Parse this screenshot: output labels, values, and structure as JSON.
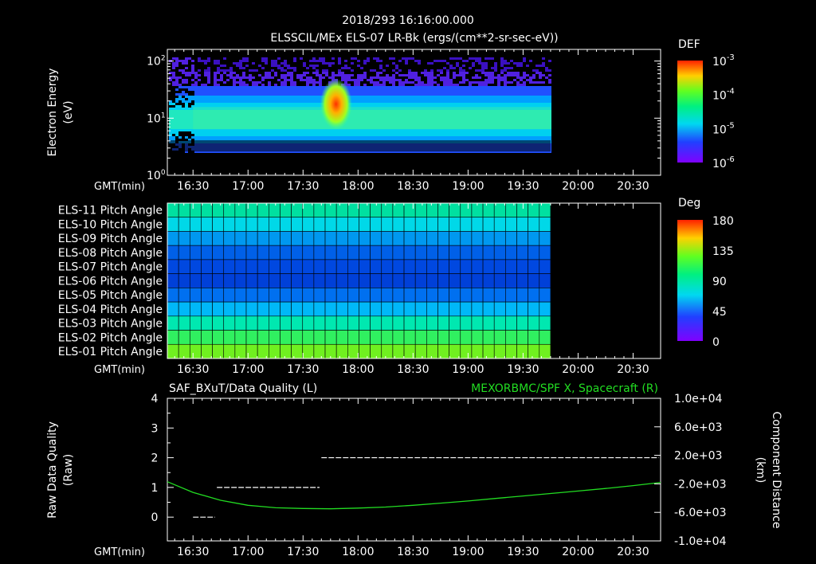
{
  "header": {
    "datetime": "2018/293 16:16:00.000",
    "title": "ELSSCIL/MEx ELS-07 LR-Bk  (ergs/(cm**2-sr-sec-eV))"
  },
  "time_axis": {
    "label": "GMT(min)",
    "ticks": [
      "16:30",
      "17:00",
      "17:30",
      "18:00",
      "18:30",
      "19:00",
      "19:30",
      "20:00",
      "20:30"
    ],
    "tick_minutes": [
      990,
      1020,
      1050,
      1080,
      1110,
      1140,
      1170,
      1200,
      1230
    ],
    "range_minutes": [
      976,
      1245
    ],
    "data_end_minutes": 1185
  },
  "panel1": {
    "ylabel_line1": "Electron Energy",
    "ylabel_line2": "(eV)",
    "ytick_base": [
      "10",
      "10",
      "10"
    ],
    "ytick_exp": [
      "0",
      "1",
      "2"
    ],
    "ytick_values": [
      1,
      10,
      100
    ],
    "yrange": [
      1,
      160
    ],
    "scale": "log",
    "colorbar": {
      "label": "DEF",
      "tick_base": [
        "10",
        "10",
        "10",
        "10"
      ],
      "tick_exp": [
        "-3",
        "-4",
        "-5",
        "-6"
      ],
      "tick_values": [
        0.001,
        0.0001,
        1e-05,
        1e-06
      ],
      "scale": "log"
    }
  },
  "panel2": {
    "rows": [
      "ELS-11 Pitch Angle",
      "ELS-10 Pitch Angle",
      "ELS-09 Pitch Angle",
      "ELS-08 Pitch Angle",
      "ELS-07 Pitch Angle",
      "ELS-06 Pitch Angle",
      "ELS-05 Pitch Angle",
      "ELS-04 Pitch Angle",
      "ELS-03 Pitch Angle",
      "ELS-02 Pitch Angle",
      "ELS-01 Pitch Angle"
    ],
    "row_colors": [
      "#00e0a0",
      "#00d8e8",
      "#0098f0",
      "#0060e8",
      "#0048e0",
      "#0040d8",
      "#0070f0",
      "#00b8f8",
      "#00e8b0",
      "#30f060",
      "#70f020"
    ],
    "colorbar": {
      "label": "Deg",
      "ticks": [
        "180",
        "135",
        "90",
        "45",
        "0"
      ],
      "tick_values": [
        180,
        135,
        90,
        45,
        0
      ]
    }
  },
  "panel3": {
    "left_title": "SAF_BXuT/Data Quality (L)",
    "right_title": "MEXORBMC/SPF X, Spacecraft (R)",
    "ylabel_line1": "Raw Data Quality",
    "ylabel_line2": "(Raw)",
    "yticks": [
      "0",
      "1",
      "2",
      "3",
      "4"
    ],
    "ytick_values": [
      0,
      1,
      2,
      3,
      4
    ],
    "yrange": [
      -0.8,
      4
    ],
    "right_label_line1": "Component Distance",
    "right_label_line2": "(km)",
    "right_ticks": [
      "1.0e+04",
      "6.0e+03",
      "2.0e+03",
      "-2.0e+03",
      "-6.0e+03",
      "-1.0e+04"
    ],
    "right_tick_values": [
      10000,
      6000,
      2000,
      -2000,
      -6000,
      -10000
    ],
    "right_range": [
      -10000,
      10000
    ]
  },
  "chart_data": [
    {
      "type": "heatmap",
      "title": "ELSSCIL/MEx ELS-07 LR-Bk  (ergs/(cm**2-sr-sec-eV))",
      "xlabel": "GMT(min)",
      "ylabel": "Electron Energy (eV)",
      "x_range": [
        "16:14",
        "20:45"
      ],
      "y_range": [
        1,
        160
      ],
      "y_scale": "log",
      "data_coverage": [
        "16:15",
        "19:45"
      ],
      "band_center_eV": 10,
      "peak": {
        "time": "17:48",
        "energy_eV": 20,
        "value": 0.0003
      },
      "colorbar": {
        "label": "DEF",
        "range": [
          1e-06,
          0.001
        ],
        "scale": "log"
      }
    },
    {
      "type": "heatmap",
      "xlabel": "GMT(min)",
      "categories": [
        "ELS-11",
        "ELS-10",
        "ELS-09",
        "ELS-08",
        "ELS-07",
        "ELS-06",
        "ELS-05",
        "ELS-04",
        "ELS-03",
        "ELS-02",
        "ELS-01"
      ],
      "values_deg": [
        100,
        80,
        55,
        40,
        33,
        30,
        45,
        75,
        100,
        115,
        125
      ],
      "data_coverage": [
        "16:15",
        "19:45"
      ],
      "colorbar": {
        "label": "Deg",
        "range": [
          0,
          180
        ]
      }
    },
    {
      "type": "line",
      "series": [
        {
          "name": "SAF_BXuT/Data Quality (L)",
          "axis": "left",
          "style": "step",
          "points": [
            [
              990,
              0
            ],
            [
              1002,
              0
            ],
            [
              1003,
              1
            ],
            [
              1059,
              1
            ],
            [
              1060,
              2
            ],
            [
              1244,
              2
            ]
          ]
        },
        {
          "name": "MEXORBMC/SPF X, Spacecraft (R)",
          "axis": "right",
          "color": "#22dd22",
          "x_minutes": [
            976,
            990,
            1005,
            1020,
            1035,
            1050,
            1065,
            1080,
            1095,
            1110,
            1125,
            1140,
            1155,
            1170,
            1185,
            1200,
            1215,
            1230,
            1245
          ],
          "values": [
            -1700,
            -3200,
            -4300,
            -5000,
            -5350,
            -5450,
            -5500,
            -5400,
            -5250,
            -5000,
            -4700,
            -4400,
            -4050,
            -3700,
            -3350,
            -3000,
            -2650,
            -2250,
            -1800
          ]
        }
      ],
      "xlabel": "GMT(min)",
      "ylim_left": [
        -0.8,
        4
      ],
      "ylim_right": [
        -10000,
        10000
      ]
    }
  ]
}
